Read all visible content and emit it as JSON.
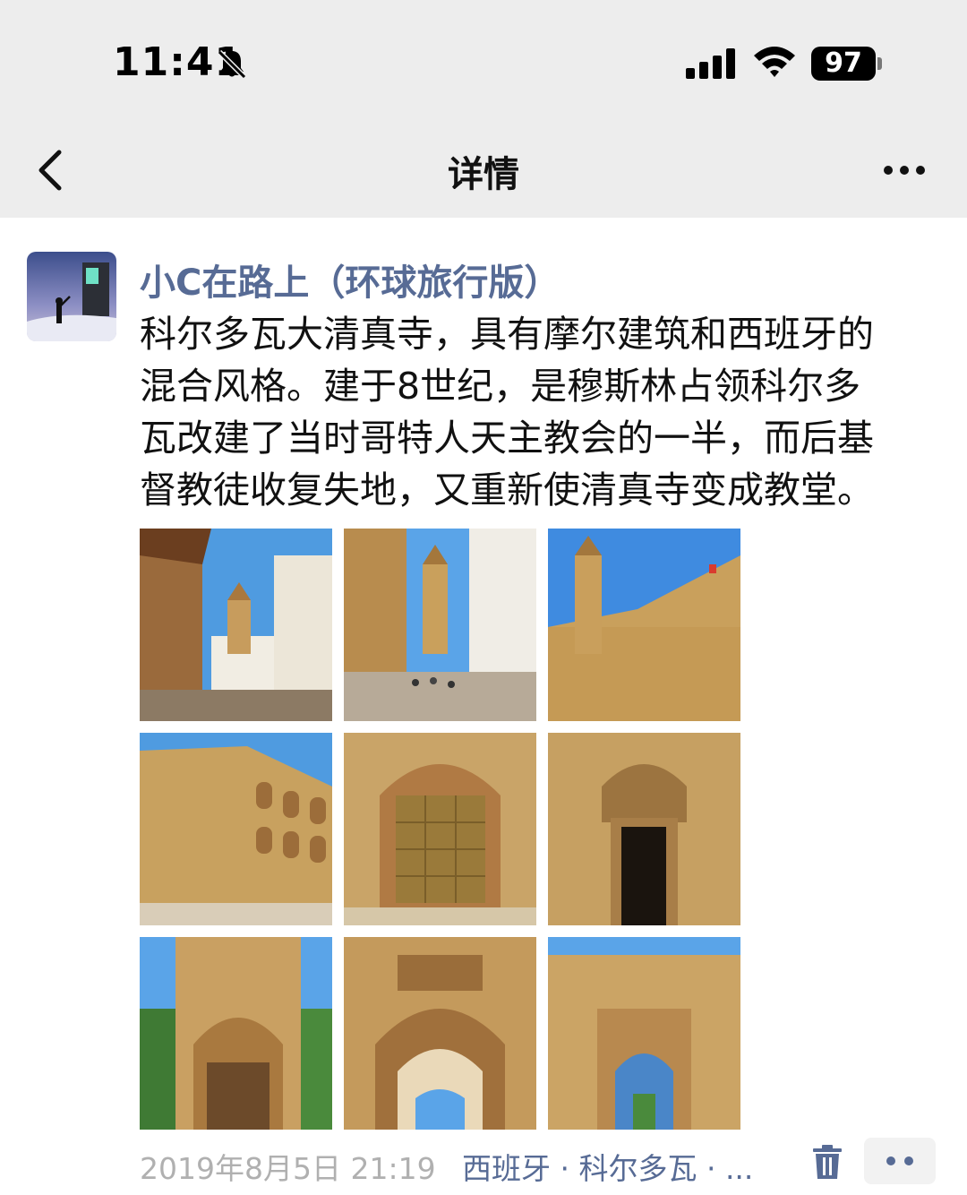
{
  "status_bar": {
    "time": "11:41",
    "battery": "97"
  },
  "nav": {
    "title": "详情"
  },
  "post": {
    "username": "小C在路上（环球旅行版）",
    "content_lines": [
      "科尔多瓦大清真寺，具有摩尔建筑和西班牙的",
      "混合风格。建于8世纪，是穆斯林占领科尔多",
      "瓦改建了当时哥特人天主教会的一半，而后基",
      "督教徒收复失地，又重新使清真寺变成教堂。"
    ],
    "photo_count": 9,
    "timestamp": "2019年8月5日 21:19",
    "location": "西班牙 · 科尔多瓦 · ..."
  },
  "colors": {
    "link": "#576b95",
    "header_bg": "#ededed",
    "meta_gray": "#b0b0b0"
  },
  "icons": [
    "bell-slash-icon",
    "signal-icon",
    "wifi-icon",
    "battery-icon",
    "back-chevron-icon",
    "more-dots-icon",
    "trash-icon",
    "comment-dots-icon"
  ]
}
